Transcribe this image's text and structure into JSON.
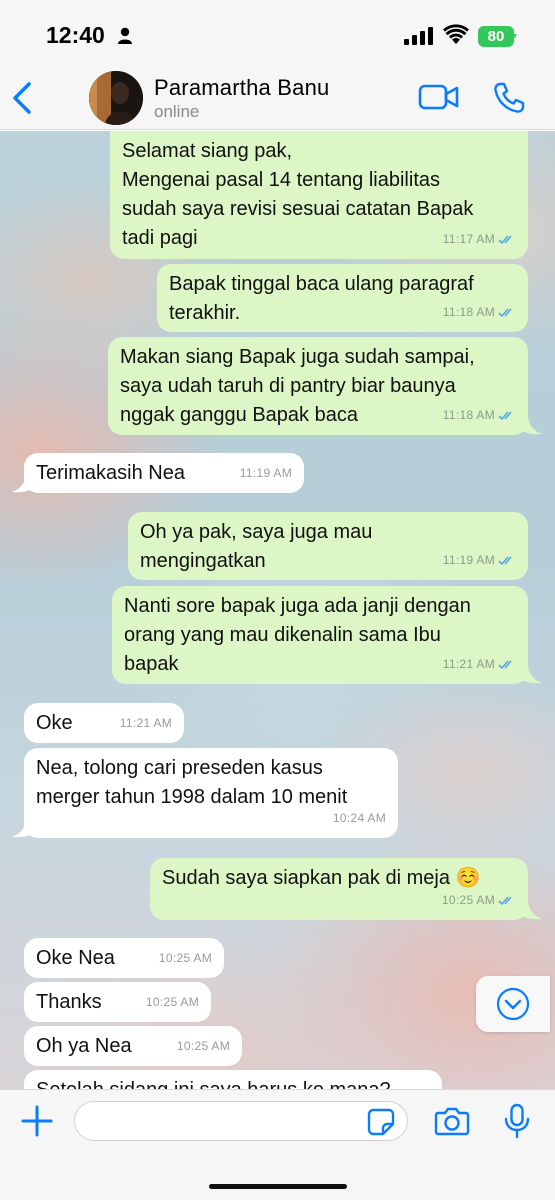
{
  "status_bar": {
    "time": "12:40",
    "battery": "80"
  },
  "header": {
    "contact_name": "Paramartha Banu",
    "contact_status": "online"
  },
  "messages": [
    {
      "direction": "out",
      "text": "Selamat siang pak,\nMengenai pasal 14 tentang liabilitas\nsudah saya revisi sesuai catatan Bapak\ntadi pagi",
      "time": "11:17 AM",
      "read": true
    },
    {
      "direction": "out",
      "text": "Bapak tinggal baca ulang paragraf\nterakhir.",
      "time": "11:18 AM",
      "read": true
    },
    {
      "direction": "out",
      "text": "Makan siang Bapak juga sudah sampai,\nsaya udah taruh di pantry biar baunya\nnggak ganggu Bapak baca",
      "time": "11:18 AM",
      "read": true
    },
    {
      "direction": "in",
      "text": "Terimakasih Nea",
      "time": "11:19 AM"
    },
    {
      "direction": "out",
      "text": "Oh ya pak, saya juga mau\nmengingatkan",
      "time": "11:19 AM",
      "read": true
    },
    {
      "direction": "out",
      "text": "Nanti sore bapak juga ada janji dengan\norang yang mau dikenalin sama Ibu\nbapak",
      "time": "11:21 AM",
      "read": true
    },
    {
      "direction": "in",
      "text": "Oke",
      "time": "11:21 AM"
    },
    {
      "direction": "in",
      "text": "Nea, tolong cari preseden kasus\nmerger tahun 1998 dalam 10 menit",
      "time": "10:24 AM"
    },
    {
      "direction": "out",
      "text": "Sudah saya siapkan pak di meja ☺️",
      "time": "10:25 AM",
      "read": true
    },
    {
      "direction": "in",
      "text": "Oke Nea",
      "time": "10:25 AM"
    },
    {
      "direction": "in",
      "text": "Thanks",
      "time": "10:25 AM"
    },
    {
      "direction": "in",
      "text": "Oh ya Nea",
      "time": "10:25 AM"
    },
    {
      "direction": "in",
      "text": "Setelah sidang ini saya harus ke mana?",
      "time": ""
    }
  ],
  "input": {
    "placeholder": "",
    "value": ""
  },
  "icons": {
    "back": "chevron-left-icon",
    "video": "video-camera-icon",
    "phone": "phone-icon",
    "plus": "plus-icon",
    "sticker": "sticker-icon",
    "camera": "camera-icon",
    "mic": "microphone-icon",
    "scroll": "chevron-down-icon"
  },
  "colors": {
    "accent": "#0a7cff",
    "outgoing_bubble": "#dcf7c5",
    "incoming_bubble": "#ffffff",
    "read_ticks": "#4fa9e8",
    "battery": "#34c759"
  }
}
